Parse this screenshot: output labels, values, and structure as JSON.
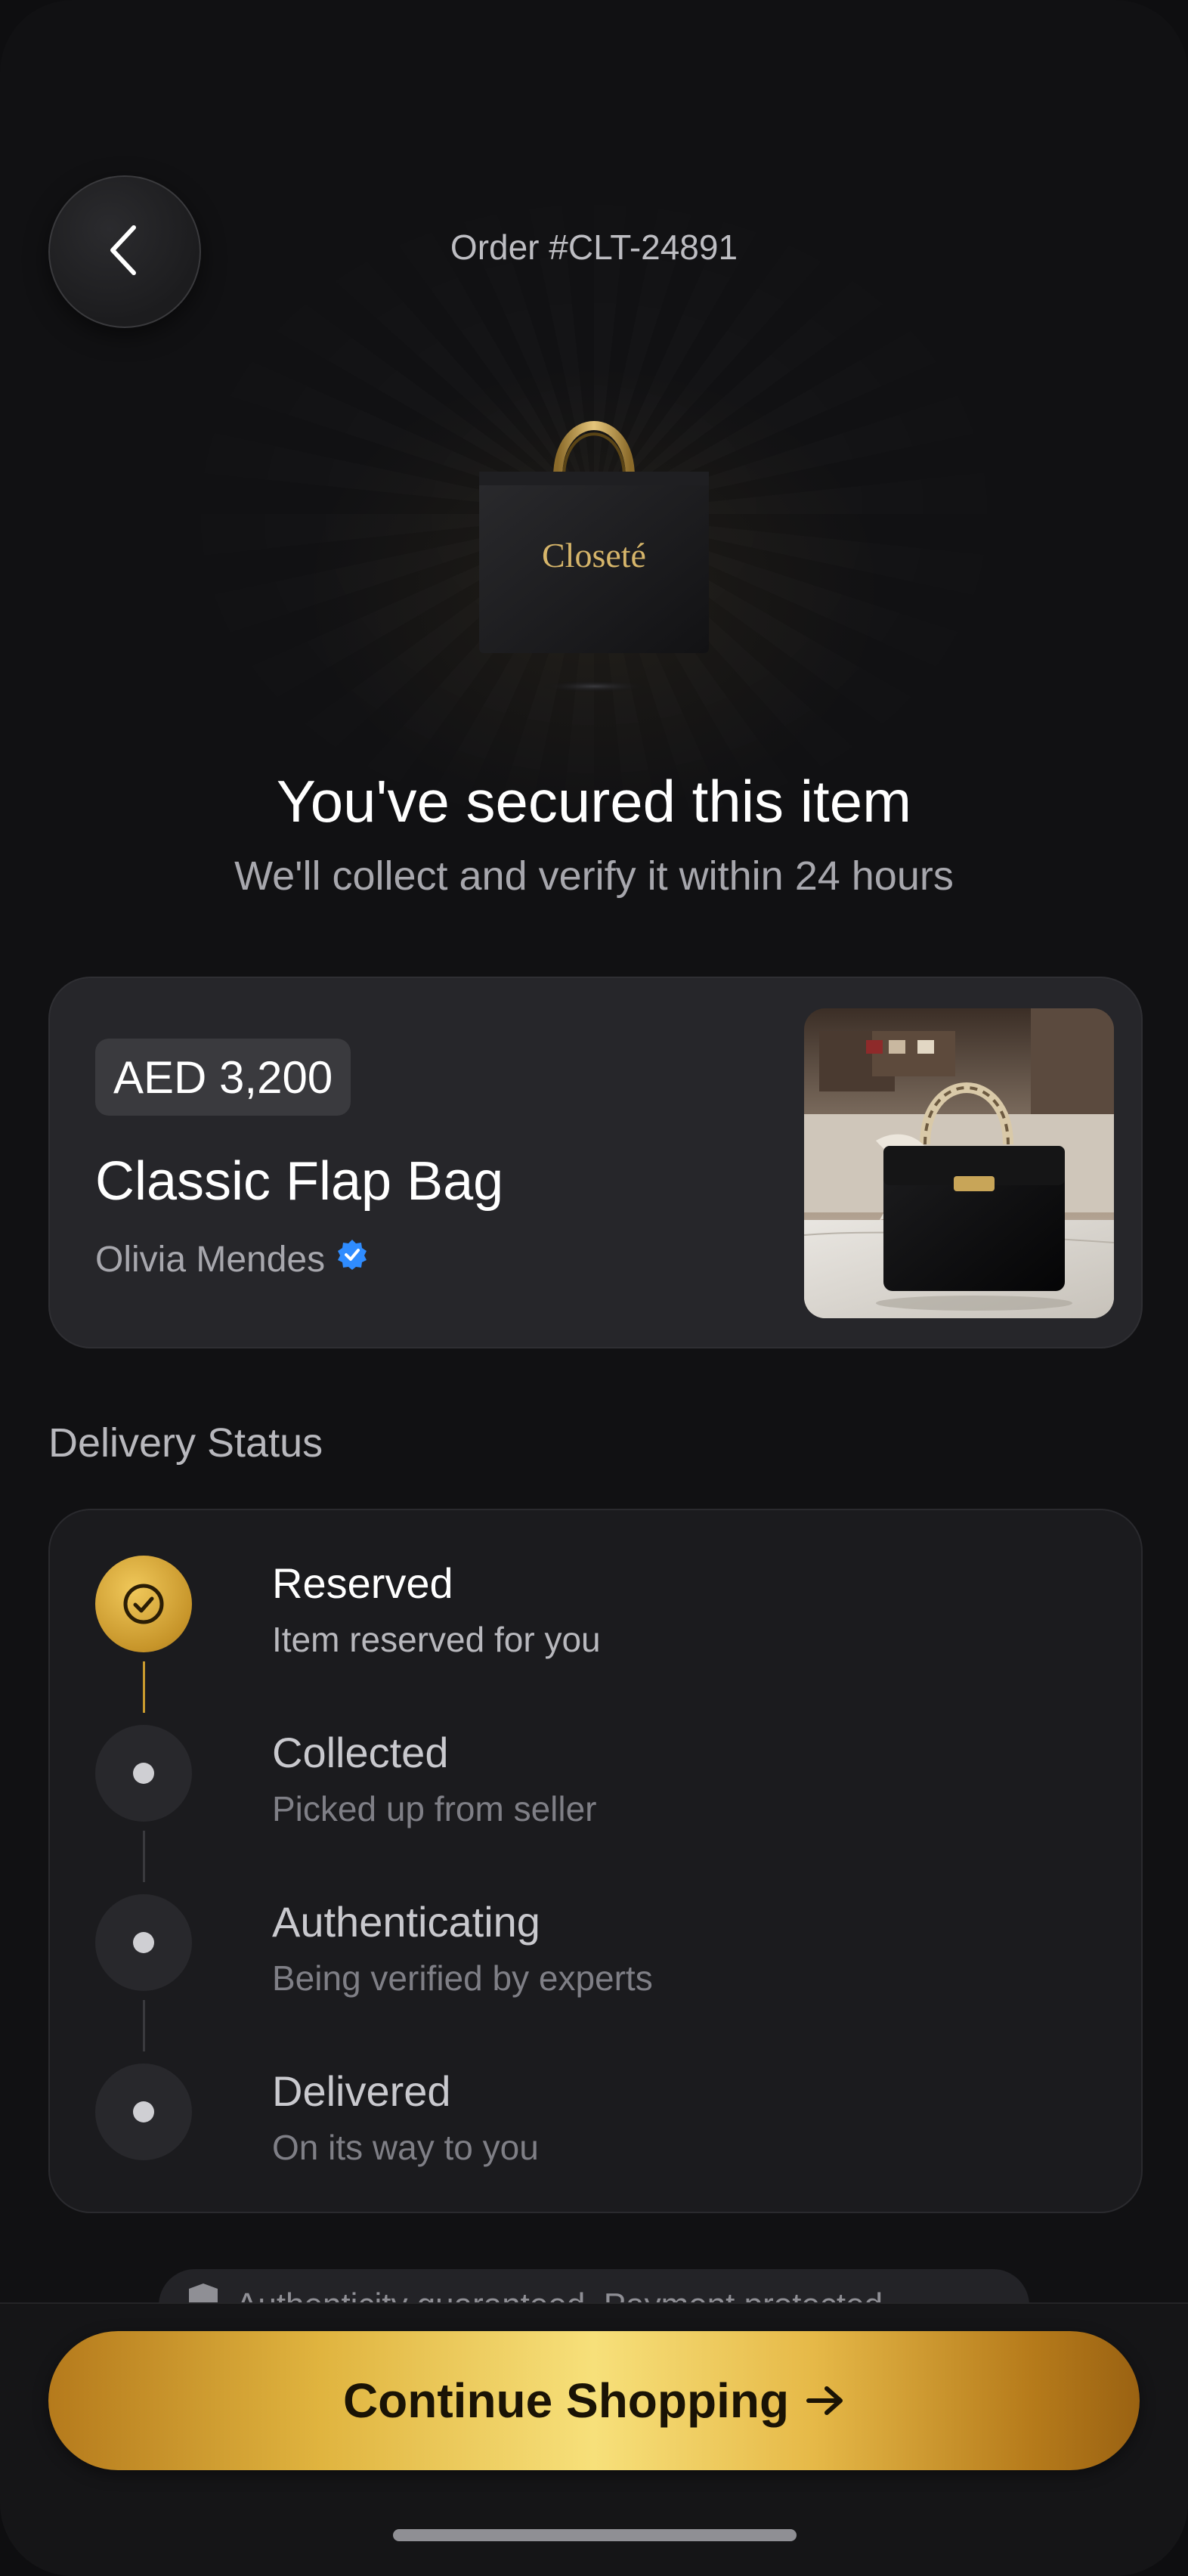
{
  "header": {
    "order_title": "Order #CLT-24891",
    "back_icon": "chevron-left-icon"
  },
  "hero": {
    "bag_brand": "Closeté",
    "headline": "You've secured this item",
    "subline": "We'll collect and verify it within 24 hours"
  },
  "item": {
    "price": "AED 3,200",
    "name": "Classic Flap Bag",
    "seller": "Olivia Mendes",
    "verified_icon": "verified-badge-icon"
  },
  "delivery": {
    "section_title": "Delivery Status",
    "steps": [
      {
        "title": "Reserved",
        "subtitle": "Item reserved for you",
        "state": "completed"
      },
      {
        "title": "Collected",
        "subtitle": "Picked up from seller",
        "state": "pending"
      },
      {
        "title": "Authenticating",
        "subtitle": "Being verified by experts",
        "state": "pending"
      },
      {
        "title": "Delivered",
        "subtitle": "On its way to you",
        "state": "pending"
      }
    ]
  },
  "assurance": {
    "text": "Authenticity guaranteed. Payment protected"
  },
  "cta": {
    "label": "Continue Shopping",
    "icon": "arrow-right-icon"
  },
  "colors": {
    "background": "#111113",
    "card": "#26262a",
    "accent_gold": "#e0b43f",
    "verified_blue": "#2f8cff"
  }
}
